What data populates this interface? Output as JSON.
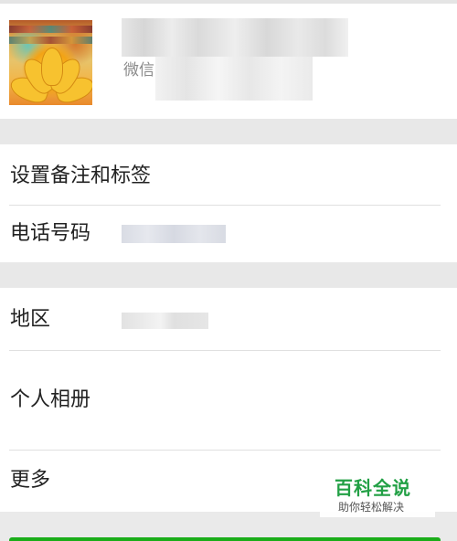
{
  "profile": {
    "wechat_label": "微信"
  },
  "rows": {
    "remark_tags": "设置备注和标签",
    "phone": "电话号码",
    "region": "地区",
    "album": "个人相册",
    "more": "更多"
  },
  "watermark": {
    "title": "百科全说",
    "subtitle": "助你轻松解决"
  },
  "colors": {
    "accent_green": "#1aad19",
    "watermark_green": "#22a045",
    "section_gap": "#e8e8e8"
  }
}
